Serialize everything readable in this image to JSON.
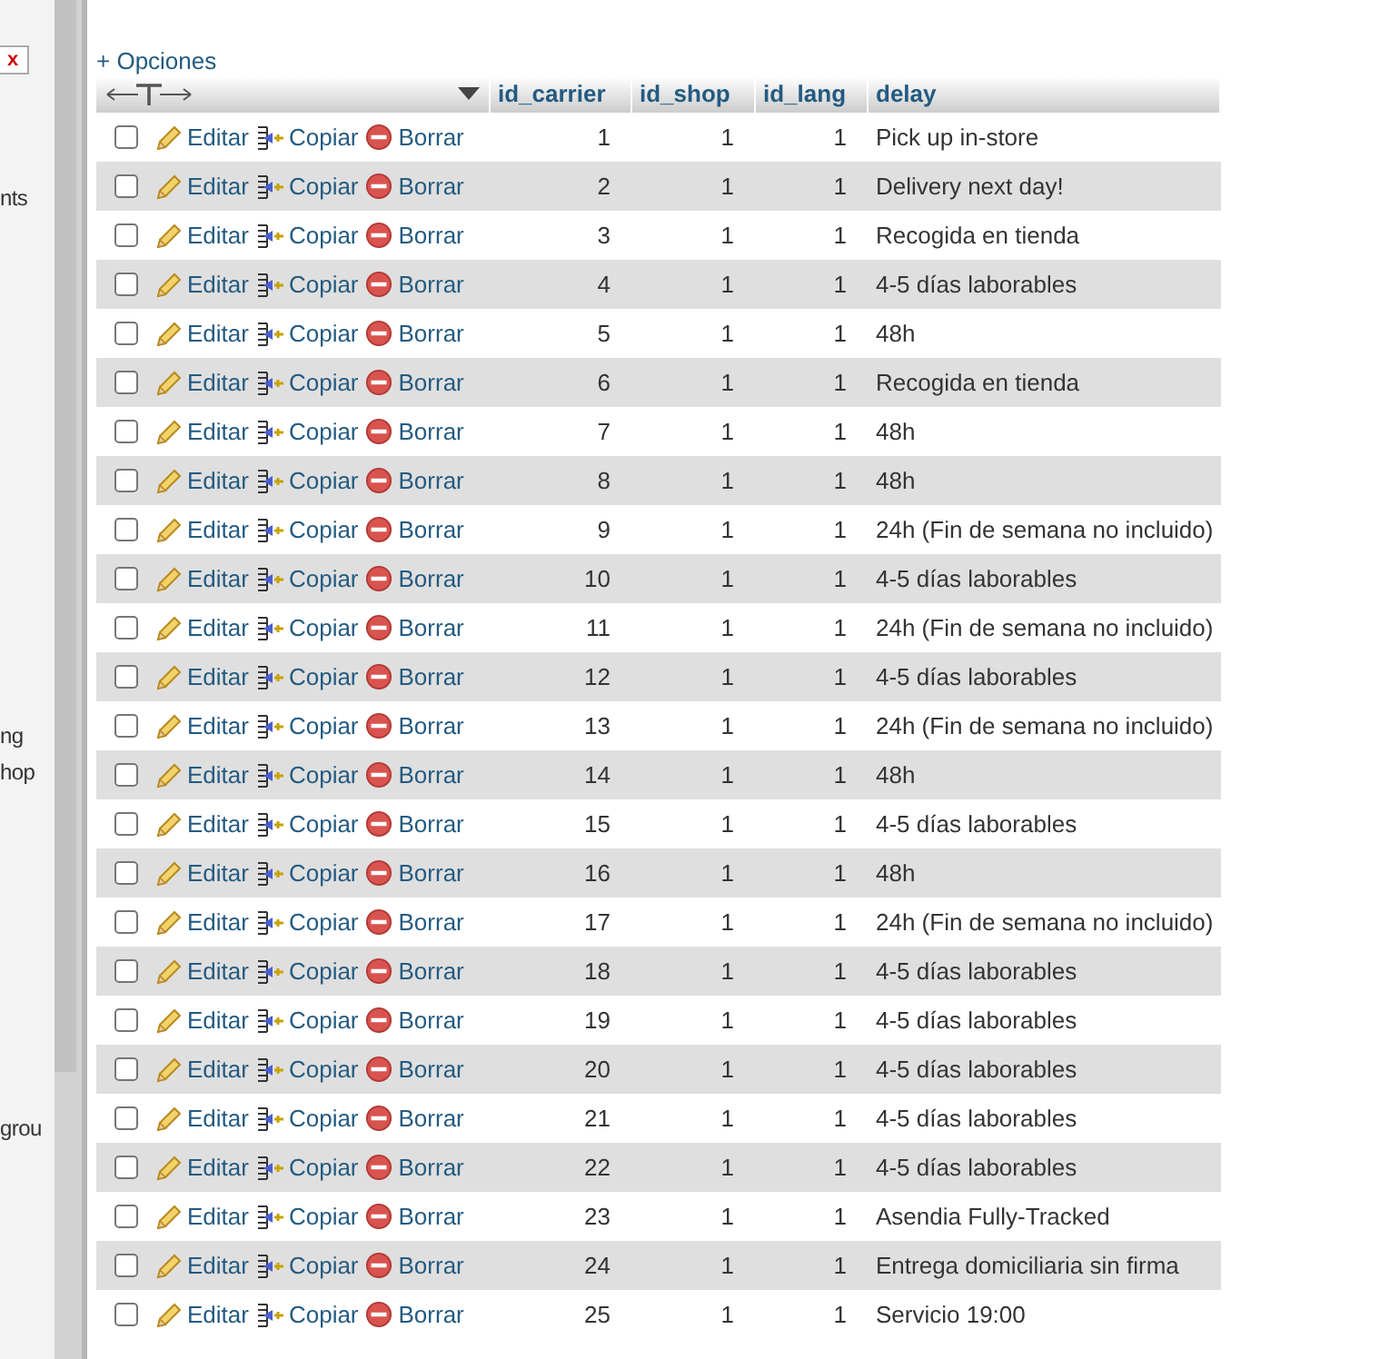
{
  "sidebar": {
    "close_button": "x",
    "items": [
      {
        "label": "nts"
      },
      {
        "label": "ng"
      },
      {
        "label": "hop"
      },
      {
        "label": "grou"
      }
    ]
  },
  "options_link": "+ Opciones",
  "table": {
    "columns": [
      "id_carrier",
      "id_shop",
      "id_lang",
      "delay"
    ],
    "rows": [
      {
        "checked": false,
        "actions": [
          "Editar",
          "Copiar",
          "Borrar"
        ],
        "cells": [
          "1",
          "1",
          "1",
          "Pick up in-store"
        ]
      },
      {
        "checked": false,
        "actions": [
          "Editar",
          "Copiar",
          "Borrar"
        ],
        "cells": [
          "2",
          "1",
          "1",
          "Delivery next day!"
        ]
      },
      {
        "checked": false,
        "actions": [
          "Editar",
          "Copiar",
          "Borrar"
        ],
        "cells": [
          "3",
          "1",
          "1",
          "Recogida en tienda"
        ]
      },
      {
        "checked": false,
        "actions": [
          "Editar",
          "Copiar",
          "Borrar"
        ],
        "cells": [
          "4",
          "1",
          "1",
          "4-5 días laborables"
        ]
      },
      {
        "checked": false,
        "actions": [
          "Editar",
          "Copiar",
          "Borrar"
        ],
        "cells": [
          "5",
          "1",
          "1",
          "48h"
        ]
      },
      {
        "checked": false,
        "actions": [
          "Editar",
          "Copiar",
          "Borrar"
        ],
        "cells": [
          "6",
          "1",
          "1",
          "Recogida en tienda"
        ]
      },
      {
        "checked": false,
        "actions": [
          "Editar",
          "Copiar",
          "Borrar"
        ],
        "cells": [
          "7",
          "1",
          "1",
          "48h"
        ]
      },
      {
        "checked": false,
        "actions": [
          "Editar",
          "Copiar",
          "Borrar"
        ],
        "cells": [
          "8",
          "1",
          "1",
          "48h"
        ]
      },
      {
        "checked": false,
        "actions": [
          "Editar",
          "Copiar",
          "Borrar"
        ],
        "cells": [
          "9",
          "1",
          "1",
          "24h (Fin de semana no incluido)"
        ]
      },
      {
        "checked": false,
        "actions": [
          "Editar",
          "Copiar",
          "Borrar"
        ],
        "cells": [
          "10",
          "1",
          "1",
          "4-5 días laborables"
        ]
      },
      {
        "checked": false,
        "actions": [
          "Editar",
          "Copiar",
          "Borrar"
        ],
        "cells": [
          "11",
          "1",
          "1",
          "24h (Fin de semana no incluido)"
        ]
      },
      {
        "checked": false,
        "actions": [
          "Editar",
          "Copiar",
          "Borrar"
        ],
        "cells": [
          "12",
          "1",
          "1",
          "4-5 días laborables"
        ]
      },
      {
        "checked": false,
        "actions": [
          "Editar",
          "Copiar",
          "Borrar"
        ],
        "cells": [
          "13",
          "1",
          "1",
          "24h (Fin de semana no incluido)"
        ]
      },
      {
        "checked": false,
        "actions": [
          "Editar",
          "Copiar",
          "Borrar"
        ],
        "cells": [
          "14",
          "1",
          "1",
          "48h"
        ]
      },
      {
        "checked": false,
        "actions": [
          "Editar",
          "Copiar",
          "Borrar"
        ],
        "cells": [
          "15",
          "1",
          "1",
          "4-5 días laborables"
        ]
      },
      {
        "checked": false,
        "actions": [
          "Editar",
          "Copiar",
          "Borrar"
        ],
        "cells": [
          "16",
          "1",
          "1",
          "48h"
        ]
      },
      {
        "checked": false,
        "actions": [
          "Editar",
          "Copiar",
          "Borrar"
        ],
        "cells": [
          "17",
          "1",
          "1",
          "24h (Fin de semana no incluido)"
        ]
      },
      {
        "checked": false,
        "actions": [
          "Editar",
          "Copiar",
          "Borrar"
        ],
        "cells": [
          "18",
          "1",
          "1",
          "4-5 días laborables"
        ]
      },
      {
        "checked": false,
        "actions": [
          "Editar",
          "Copiar",
          "Borrar"
        ],
        "cells": [
          "19",
          "1",
          "1",
          "4-5 días laborables"
        ]
      },
      {
        "checked": false,
        "actions": [
          "Editar",
          "Copiar",
          "Borrar"
        ],
        "cells": [
          "20",
          "1",
          "1",
          "4-5 días laborables"
        ]
      },
      {
        "checked": false,
        "actions": [
          "Editar",
          "Copiar",
          "Borrar"
        ],
        "cells": [
          "21",
          "1",
          "1",
          "4-5 días laborables"
        ]
      },
      {
        "checked": false,
        "actions": [
          "Editar",
          "Copiar",
          "Borrar"
        ],
        "cells": [
          "22",
          "1",
          "1",
          "4-5 días laborables"
        ]
      },
      {
        "checked": false,
        "actions": [
          "Editar",
          "Copiar",
          "Borrar"
        ],
        "cells": [
          "23",
          "1",
          "1",
          "Asendia Fully-Tracked"
        ]
      },
      {
        "checked": false,
        "actions": [
          "Editar",
          "Copiar",
          "Borrar"
        ],
        "cells": [
          "24",
          "1",
          "1",
          "Entrega domiciliaria sin firma"
        ]
      },
      {
        "checked": false,
        "actions": [
          "Editar",
          "Copiar",
          "Borrar"
        ],
        "cells": [
          "25",
          "1",
          "1",
          "Servicio 19:00"
        ]
      }
    ]
  }
}
